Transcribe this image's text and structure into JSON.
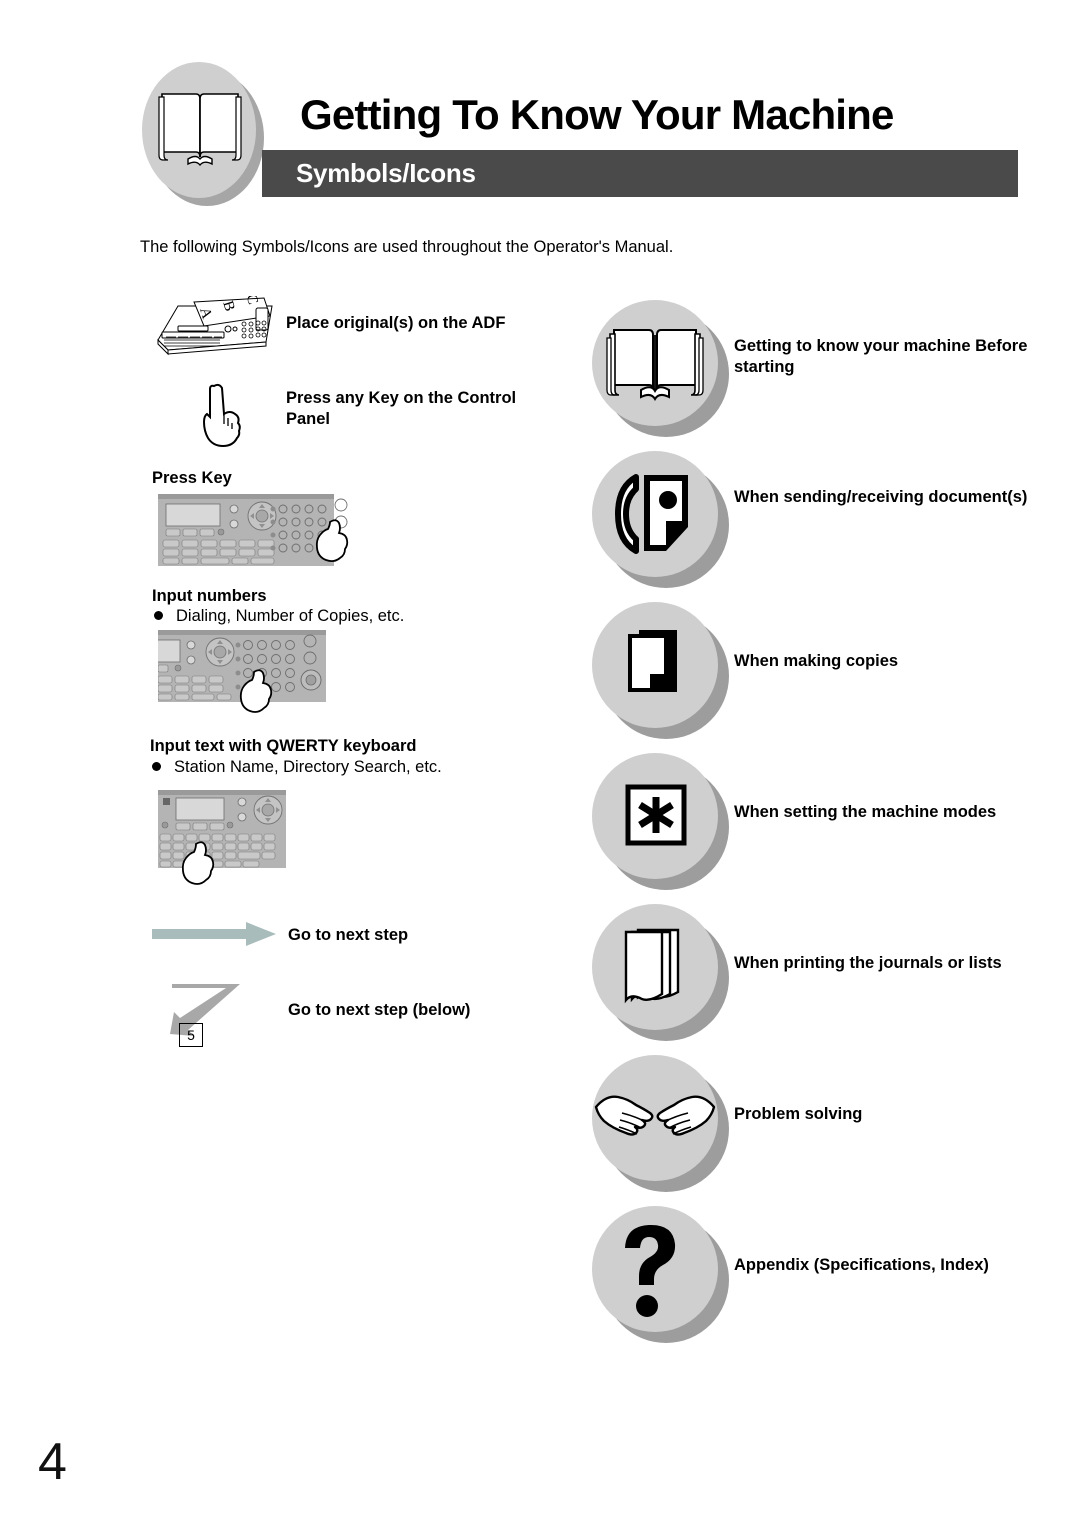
{
  "header": {
    "title": "Getting To Know Your Machine",
    "band_label": "Symbols/Icons",
    "medallion_icon": "open-book-icon",
    "band_color": "#4a4a4a",
    "medallion_color": "#cfcfcf"
  },
  "intro": "The following Symbols/Icons are used throughout the Operator's Manual.",
  "left_column": {
    "items": [
      {
        "art": "machine-adf-illustration",
        "label": "Place original(s) on the ADF",
        "sublabel": "",
        "bullet": ""
      },
      {
        "art": "pointing-hand-illustration",
        "label": "Press any Key on the Control Panel",
        "sublabel": "",
        "bullet": ""
      },
      {
        "art": "control-panel-press-key-illustration",
        "label": "Press Key",
        "sublabel": "",
        "bullet": ""
      },
      {
        "art": "control-panel-keypad-illustration",
        "label": "Input numbers",
        "sublabel": "Dialing, Number of Copies, etc.",
        "bullet": "●"
      },
      {
        "art": "control-panel-qwerty-illustration",
        "label": "Input text with QWERTY keyboard",
        "sublabel": "Station Name, Directory Search, etc.",
        "bullet": "●"
      },
      {
        "art": "right-arrow-icon",
        "label": "Go to next step",
        "sublabel": "",
        "bullet": ""
      },
      {
        "art": "zigzag-arrow-icon",
        "label": "Go to next step (below)",
        "sublabel": "",
        "bullet": ""
      }
    ],
    "step_box_number": "5",
    "arrow_color": "#a9bcbc",
    "zigzag_color": "#a8a8a8"
  },
  "right_column": {
    "items": [
      {
        "icon": "open-book-icon",
        "label": "Getting to know your machine Before starting"
      },
      {
        "icon": "fax-handset-icon",
        "label": "When sending/receiving document(s)"
      },
      {
        "icon": "copy-pages-icon",
        "label": "When making copies"
      },
      {
        "icon": "asterisk-box-icon",
        "label": "When setting the machine modes"
      },
      {
        "icon": "paper-stack-icon",
        "label": "When printing the journals or lists"
      },
      {
        "icon": "two-hands-icon",
        "label": "Problem solving"
      },
      {
        "icon": "question-mark-icon",
        "label": "Appendix (Specifications, Index)"
      }
    ]
  },
  "page_number": "4"
}
